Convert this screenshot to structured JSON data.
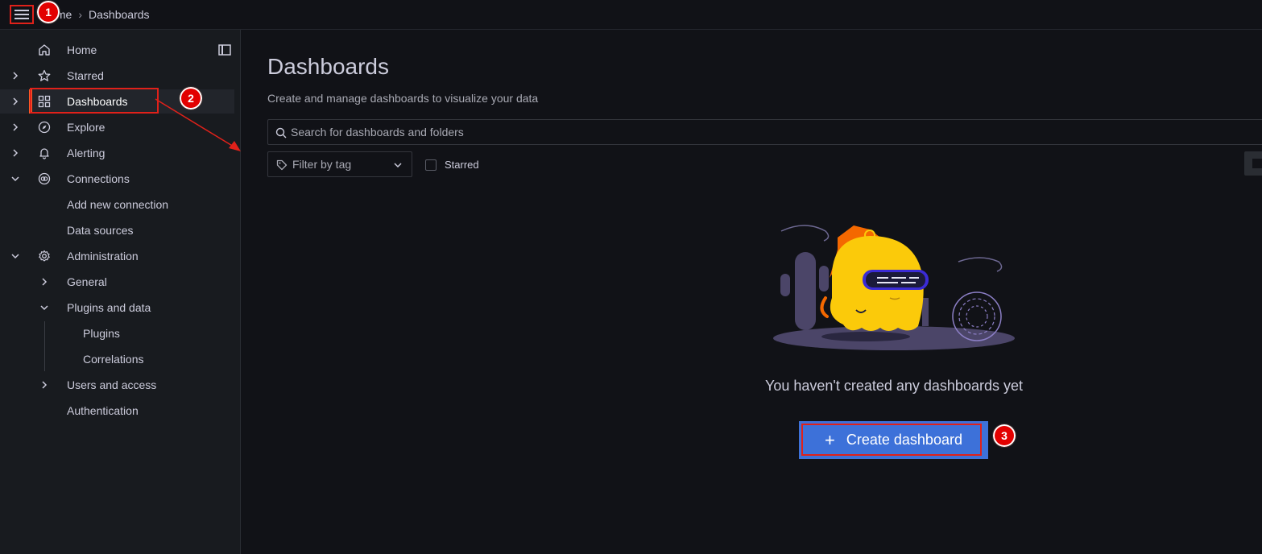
{
  "breadcrumb": {
    "home_label": "Home",
    "current_label": "Dashboards"
  },
  "sidebar": {
    "items": [
      {
        "label": "Home",
        "icon": "home-icon"
      },
      {
        "label": "Starred",
        "icon": "star-icon"
      },
      {
        "label": "Dashboards",
        "icon": "apps-grid-icon"
      },
      {
        "label": "Explore",
        "icon": "compass-icon"
      },
      {
        "label": "Alerting",
        "icon": "bell-icon"
      },
      {
        "label": "Connections",
        "icon": "link-icon"
      },
      {
        "label": "Add new connection"
      },
      {
        "label": "Data sources"
      },
      {
        "label": "Administration",
        "icon": "gear-icon"
      },
      {
        "label": "General"
      },
      {
        "label": "Plugins and data"
      },
      {
        "label": "Plugins"
      },
      {
        "label": "Correlations"
      },
      {
        "label": "Users and access"
      },
      {
        "label": "Authentication"
      }
    ]
  },
  "main": {
    "title": "Dashboards",
    "subtitle": "Create and manage dashboards to visualize your data",
    "search_placeholder": "Search for dashboards and folders",
    "filter_placeholder": "Filter by tag",
    "starred_label": "Starred",
    "empty_message": "You haven't created any dashboards yet",
    "create_button_label": "Create dashboard"
  },
  "annotations": {
    "badge1": "1",
    "badge2": "2",
    "badge3": "3"
  },
  "colors": {
    "accent": "#3d71d9",
    "annotation_red": "#e0211a",
    "sidebar_bg": "#181b1f",
    "page_bg": "#111217"
  }
}
